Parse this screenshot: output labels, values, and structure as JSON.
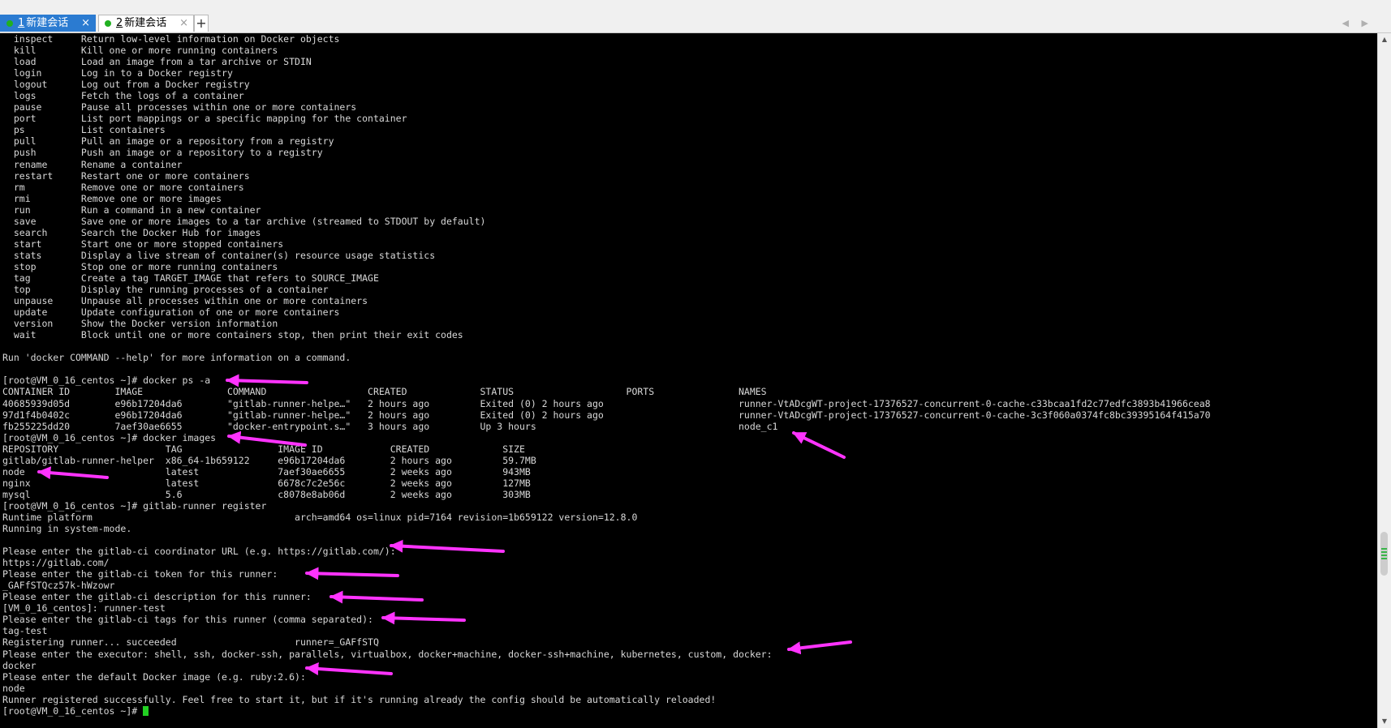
{
  "tabs": [
    {
      "number": "1",
      "title": "新建会话",
      "close": "×",
      "active": true
    },
    {
      "number": "2",
      "title": "新建会话",
      "close": "×",
      "active": false
    }
  ],
  "add_tab": "+",
  "nav_arrows": "◀ ▶",
  "scrollbar": {
    "up": "▲",
    "down": "▼"
  },
  "colors": {
    "terminal_bg": "#000000",
    "terminal_text": "#d8d8d8",
    "active_tab": "#2b7bd1",
    "session_dot": "#21b021",
    "arrow": "#ff33ff",
    "cursor": "#22d022"
  },
  "terminal": {
    "lines": [
      "  inspect     Return low-level information on Docker objects",
      "  kill        Kill one or more running containers",
      "  load        Load an image from a tar archive or STDIN",
      "  login       Log in to a Docker registry",
      "  logout      Log out from a Docker registry",
      "  logs        Fetch the logs of a container",
      "  pause       Pause all processes within one or more containers",
      "  port        List port mappings or a specific mapping for the container",
      "  ps          List containers",
      "  pull        Pull an image or a repository from a registry",
      "  push        Push an image or a repository to a registry",
      "  rename      Rename a container",
      "  restart     Restart one or more containers",
      "  rm          Remove one or more containers",
      "  rmi         Remove one or more images",
      "  run         Run a command in a new container",
      "  save        Save one or more images to a tar archive (streamed to STDOUT by default)",
      "  search      Search the Docker Hub for images",
      "  start       Start one or more stopped containers",
      "  stats       Display a live stream of container(s) resource usage statistics",
      "  stop        Stop one or more running containers",
      "  tag         Create a tag TARGET_IMAGE that refers to SOURCE_IMAGE",
      "  top         Display the running processes of a container",
      "  unpause     Unpause all processes within one or more containers",
      "  update      Update configuration of one or more containers",
      "  version     Show the Docker version information",
      "  wait        Block until one or more containers stop, then print their exit codes",
      "",
      "Run 'docker COMMAND --help' for more information on a command.",
      "",
      "[root@VM_0_16_centos ~]# docker ps -a",
      "CONTAINER ID        IMAGE               COMMAND                  CREATED             STATUS                    PORTS               NAMES",
      "40685939d05d        e96b17204da6        \"gitlab-runner-helpe…\"   2 hours ago         Exited (0) 2 hours ago                        runner-VtADcgWT-project-17376527-concurrent-0-cache-c33bcaa1fd2c77edfc3893b41966cea8",
      "97d1f4b0402c        e96b17204da6        \"gitlab-runner-helpe…\"   2 hours ago         Exited (0) 2 hours ago                        runner-VtADcgWT-project-17376527-concurrent-0-cache-3c3f060a0374fc8bc39395164f415a70",
      "fb255225dd20        7aef30ae6655        \"docker-entrypoint.s…\"   3 hours ago         Up 3 hours                                    node_c1",
      "[root@VM_0_16_centos ~]# docker images",
      "REPOSITORY                   TAG                 IMAGE ID            CREATED             SIZE",
      "gitlab/gitlab-runner-helper  x86_64-1b659122     e96b17204da6        2 hours ago         59.7MB",
      "node                         latest              7aef30ae6655        2 weeks ago         943MB",
      "nginx                        latest              6678c7c2e56c        2 weeks ago         127MB",
      "mysql                        5.6                 c8078e8ab06d        2 weeks ago         303MB",
      "[root@VM_0_16_centos ~]# gitlab-runner register",
      "Runtime platform                                    arch=amd64 os=linux pid=7164 revision=1b659122 version=12.8.0",
      "Running in system-mode.",
      "",
      "Please enter the gitlab-ci coordinator URL (e.g. https://gitlab.com/):",
      "https://gitlab.com/",
      "Please enter the gitlab-ci token for this runner:",
      "_GAFfSTQcz57k-hWzowr",
      "Please enter the gitlab-ci description for this runner:",
      "[VM_0_16_centos]: runner-test",
      "Please enter the gitlab-ci tags for this runner (comma separated):",
      "tag-test",
      "Registering runner... succeeded                     runner=_GAFfSTQ",
      "Please enter the executor: shell, ssh, docker-ssh, parallels, virtualbox, docker+machine, docker-ssh+machine, kubernetes, custom, docker:",
      "docker",
      "Please enter the default Docker image (e.g. ruby:2.6):",
      "node",
      "Runner registered successfully. Feel free to start it, but if it's running already the config should be automatically reloaded!",
      "[root@VM_0_16_centos ~]# "
    ]
  }
}
